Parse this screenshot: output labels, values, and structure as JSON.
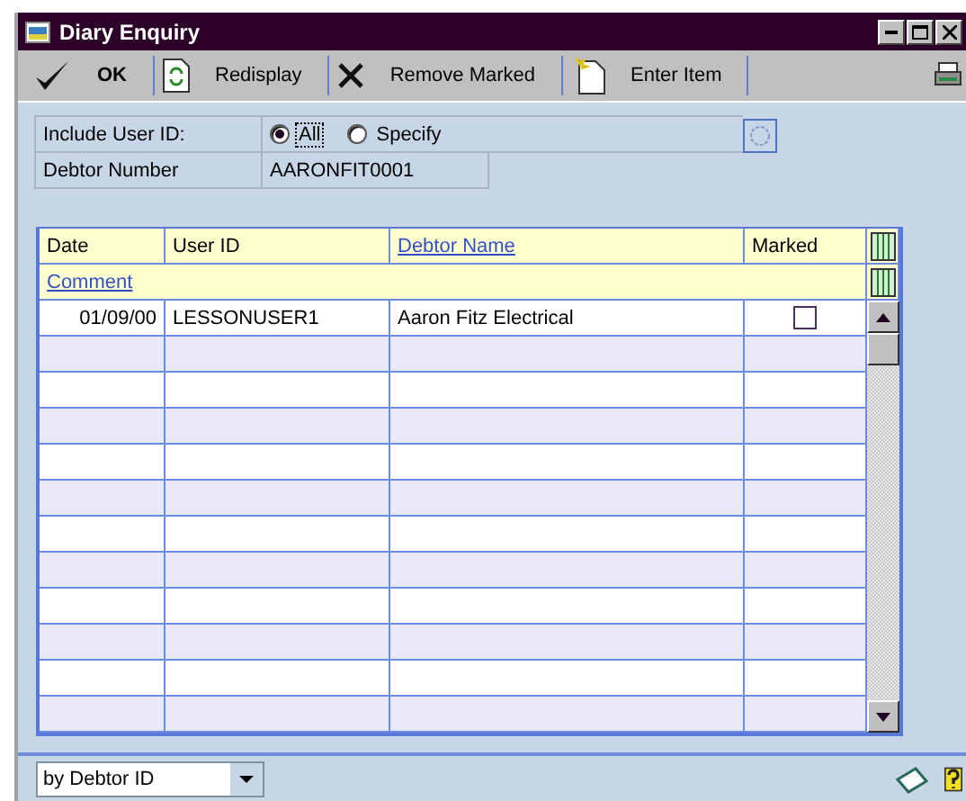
{
  "window": {
    "title": "Diary Enquiry"
  },
  "toolbar": [
    {
      "kind": "check",
      "label": "OK"
    },
    {
      "kind": "redisplay",
      "label": "Redisplay"
    },
    {
      "kind": "remove",
      "label": "Remove Marked"
    },
    {
      "kind": "enter",
      "label": "Enter Item"
    }
  ],
  "filter": {
    "label": "Include User ID:",
    "options": [
      {
        "label": "All",
        "selected": true
      },
      {
        "label": "Specify",
        "selected": false
      }
    ]
  },
  "debtor": {
    "label": "Debtor Number",
    "value": "AARONFIT0001"
  },
  "table": {
    "columns": [
      {
        "label": "Date",
        "link": false
      },
      {
        "label": "User ID",
        "link": false
      },
      {
        "label": "Debtor Name",
        "link": true
      },
      {
        "label": "Marked",
        "link": false
      }
    ],
    "second_header": {
      "label": "Comment",
      "link": true
    },
    "rows": [
      {
        "date": "01/09/00",
        "user_id": "LESSONUSER1",
        "debtor_name": "Aaron Fitz Electrical",
        "marked": false
      }
    ]
  },
  "sort": {
    "value": "by Debtor ID"
  }
}
